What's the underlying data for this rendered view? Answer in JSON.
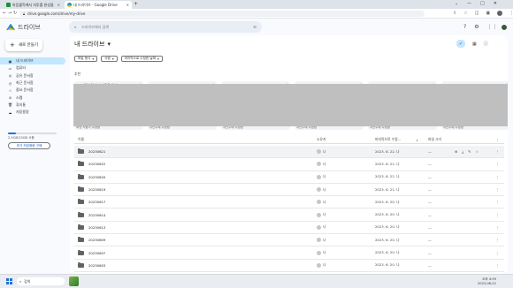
{
  "browser": {
    "tabs": [
      {
        "title": "마음블럭에서 자투를 완성을"
      },
      {
        "title": "내 드라이브 - Google Drive"
      }
    ],
    "url": "drive.google.com/drive/my-drive"
  },
  "app": {
    "logo_text": "드라이브",
    "search_placeholder": "드라이브에서 검색"
  },
  "sidebar": {
    "new_label": "새로 만들기",
    "items": [
      {
        "label": "내 드라이브",
        "icon": "drive-icon"
      },
      {
        "label": "컴퓨터",
        "icon": "computer-icon"
      },
      {
        "label": "공유 문서함",
        "icon": "shared-icon"
      },
      {
        "label": "최근 문서함",
        "icon": "clock-icon"
      },
      {
        "label": "중요 문서함",
        "icon": "star-icon"
      },
      {
        "label": "스팸",
        "icon": "spam-icon"
      },
      {
        "label": "휴지통",
        "icon": "trash-icon"
      },
      {
        "label": "저장용량",
        "icon": "cloud-icon"
      }
    ],
    "storage_text": "2.5GB/15GB 사용",
    "storage_fraction": 0.17,
    "buy_label": "추가 저장용량 구매"
  },
  "main": {
    "title": "내 드라이브",
    "filters": [
      "파일 형식",
      "사람",
      "마지막으로 수정한 날짜"
    ],
    "suggested_label": "추천",
    "cards": [
      {
        "name": "마음블럭에서 자투를 완성...",
        "type": "sheet",
        "footer": "보낸 사람이 수정함"
      },
      {
        "name": "IMG_20230618_165807_...",
        "type": "img",
        "footer": "지난주에 수정함"
      },
      {
        "name": "20230621_031959.mp4",
        "type": "vid",
        "footer": "지난주에 수정함"
      },
      {
        "name": "IMG_20230618_165807_57...",
        "type": "img",
        "footer": "지난주에 수정함"
      },
      {
        "name": "20230526_181236.mp4",
        "type": "vid",
        "footer": "지난주에 수정함"
      },
      {
        "name": "20230526_180137.mp4",
        "type": "vid",
        "footer": "지난주에 수정함"
      }
    ],
    "columns": {
      "name": "이름",
      "owner": "소유자",
      "modified": "마지막으로 수정...",
      "size": "파일 크기"
    },
    "rows": [
      {
        "name": "20230621",
        "owner": "나",
        "date": "2023. 6. 22. 나",
        "size": "—"
      },
      {
        "name": "20230622",
        "owner": "나",
        "date": "2023. 6. 22. 나",
        "size": "—"
      },
      {
        "name": "20230620",
        "owner": "나",
        "date": "2023. 6. 22. 나",
        "size": "—"
      },
      {
        "name": "20230619",
        "owner": "나",
        "date": "2023. 6. 21. 나",
        "size": "—"
      },
      {
        "name": "20230617",
        "owner": "나",
        "date": "2023. 6. 20. 나",
        "size": "—"
      },
      {
        "name": "20230614",
        "owner": "나",
        "date": "2023. 6. 20. 나",
        "size": "—"
      },
      {
        "name": "20230613",
        "owner": "나",
        "date": "2023. 6. 20. 나",
        "size": "—"
      },
      {
        "name": "20230609",
        "owner": "나",
        "date": "2023. 6. 20. 나",
        "size": "—"
      },
      {
        "name": "20230607",
        "owner": "나",
        "date": "2023. 6. 20. 나",
        "size": "—"
      },
      {
        "name": "20230603",
        "owner": "나",
        "date": "2023. 6. 20. 나",
        "size": "—"
      }
    ]
  },
  "taskbar": {
    "search_label": "검색",
    "time": "오후 4:59",
    "date": "2023-06-22"
  }
}
